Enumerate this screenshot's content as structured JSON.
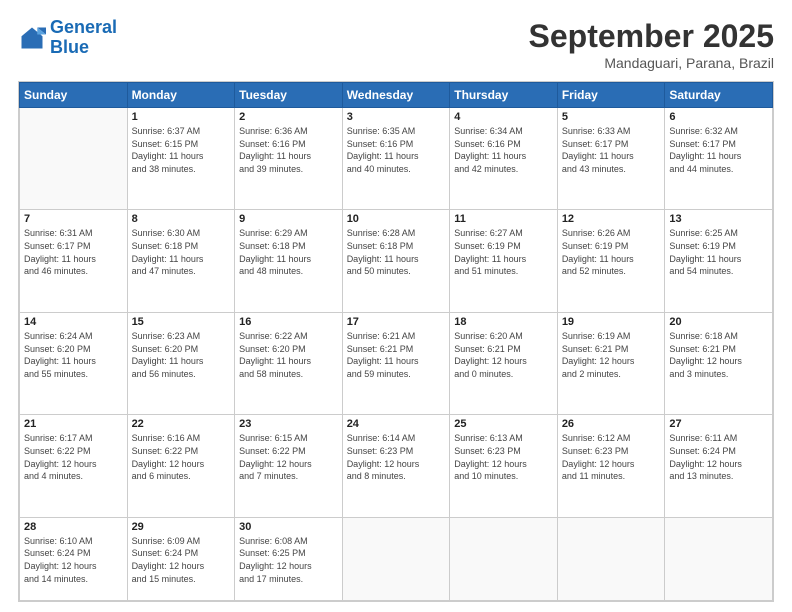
{
  "logo": {
    "line1": "General",
    "line2": "Blue"
  },
  "title": "September 2025",
  "subtitle": "Mandaguari, Parana, Brazil",
  "weekdays": [
    "Sunday",
    "Monday",
    "Tuesday",
    "Wednesday",
    "Thursday",
    "Friday",
    "Saturday"
  ],
  "weeks": [
    [
      {
        "day": "",
        "info": ""
      },
      {
        "day": "1",
        "info": "Sunrise: 6:37 AM\nSunset: 6:15 PM\nDaylight: 11 hours\nand 38 minutes."
      },
      {
        "day": "2",
        "info": "Sunrise: 6:36 AM\nSunset: 6:16 PM\nDaylight: 11 hours\nand 39 minutes."
      },
      {
        "day": "3",
        "info": "Sunrise: 6:35 AM\nSunset: 6:16 PM\nDaylight: 11 hours\nand 40 minutes."
      },
      {
        "day": "4",
        "info": "Sunrise: 6:34 AM\nSunset: 6:16 PM\nDaylight: 11 hours\nand 42 minutes."
      },
      {
        "day": "5",
        "info": "Sunrise: 6:33 AM\nSunset: 6:17 PM\nDaylight: 11 hours\nand 43 minutes."
      },
      {
        "day": "6",
        "info": "Sunrise: 6:32 AM\nSunset: 6:17 PM\nDaylight: 11 hours\nand 44 minutes."
      }
    ],
    [
      {
        "day": "7",
        "info": "Sunrise: 6:31 AM\nSunset: 6:17 PM\nDaylight: 11 hours\nand 46 minutes."
      },
      {
        "day": "8",
        "info": "Sunrise: 6:30 AM\nSunset: 6:18 PM\nDaylight: 11 hours\nand 47 minutes."
      },
      {
        "day": "9",
        "info": "Sunrise: 6:29 AM\nSunset: 6:18 PM\nDaylight: 11 hours\nand 48 minutes."
      },
      {
        "day": "10",
        "info": "Sunrise: 6:28 AM\nSunset: 6:18 PM\nDaylight: 11 hours\nand 50 minutes."
      },
      {
        "day": "11",
        "info": "Sunrise: 6:27 AM\nSunset: 6:19 PM\nDaylight: 11 hours\nand 51 minutes."
      },
      {
        "day": "12",
        "info": "Sunrise: 6:26 AM\nSunset: 6:19 PM\nDaylight: 11 hours\nand 52 minutes."
      },
      {
        "day": "13",
        "info": "Sunrise: 6:25 AM\nSunset: 6:19 PM\nDaylight: 11 hours\nand 54 minutes."
      }
    ],
    [
      {
        "day": "14",
        "info": "Sunrise: 6:24 AM\nSunset: 6:20 PM\nDaylight: 11 hours\nand 55 minutes."
      },
      {
        "day": "15",
        "info": "Sunrise: 6:23 AM\nSunset: 6:20 PM\nDaylight: 11 hours\nand 56 minutes."
      },
      {
        "day": "16",
        "info": "Sunrise: 6:22 AM\nSunset: 6:20 PM\nDaylight: 11 hours\nand 58 minutes."
      },
      {
        "day": "17",
        "info": "Sunrise: 6:21 AM\nSunset: 6:21 PM\nDaylight: 11 hours\nand 59 minutes."
      },
      {
        "day": "18",
        "info": "Sunrise: 6:20 AM\nSunset: 6:21 PM\nDaylight: 12 hours\nand 0 minutes."
      },
      {
        "day": "19",
        "info": "Sunrise: 6:19 AM\nSunset: 6:21 PM\nDaylight: 12 hours\nand 2 minutes."
      },
      {
        "day": "20",
        "info": "Sunrise: 6:18 AM\nSunset: 6:21 PM\nDaylight: 12 hours\nand 3 minutes."
      }
    ],
    [
      {
        "day": "21",
        "info": "Sunrise: 6:17 AM\nSunset: 6:22 PM\nDaylight: 12 hours\nand 4 minutes."
      },
      {
        "day": "22",
        "info": "Sunrise: 6:16 AM\nSunset: 6:22 PM\nDaylight: 12 hours\nand 6 minutes."
      },
      {
        "day": "23",
        "info": "Sunrise: 6:15 AM\nSunset: 6:22 PM\nDaylight: 12 hours\nand 7 minutes."
      },
      {
        "day": "24",
        "info": "Sunrise: 6:14 AM\nSunset: 6:23 PM\nDaylight: 12 hours\nand 8 minutes."
      },
      {
        "day": "25",
        "info": "Sunrise: 6:13 AM\nSunset: 6:23 PM\nDaylight: 12 hours\nand 10 minutes."
      },
      {
        "day": "26",
        "info": "Sunrise: 6:12 AM\nSunset: 6:23 PM\nDaylight: 12 hours\nand 11 minutes."
      },
      {
        "day": "27",
        "info": "Sunrise: 6:11 AM\nSunset: 6:24 PM\nDaylight: 12 hours\nand 13 minutes."
      }
    ],
    [
      {
        "day": "28",
        "info": "Sunrise: 6:10 AM\nSunset: 6:24 PM\nDaylight: 12 hours\nand 14 minutes."
      },
      {
        "day": "29",
        "info": "Sunrise: 6:09 AM\nSunset: 6:24 PM\nDaylight: 12 hours\nand 15 minutes."
      },
      {
        "day": "30",
        "info": "Sunrise: 6:08 AM\nSunset: 6:25 PM\nDaylight: 12 hours\nand 17 minutes."
      },
      {
        "day": "",
        "info": ""
      },
      {
        "day": "",
        "info": ""
      },
      {
        "day": "",
        "info": ""
      },
      {
        "day": "",
        "info": ""
      }
    ]
  ]
}
